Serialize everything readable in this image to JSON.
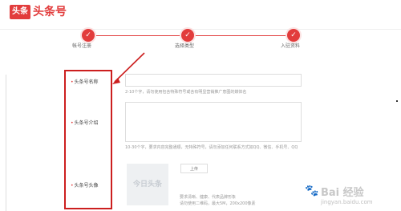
{
  "header": {
    "logo_badge": "头条",
    "logo_text": "头条号"
  },
  "steps": [
    {
      "label": "帐号注册",
      "icon": "check-icon"
    },
    {
      "label": "选择类型",
      "icon": "check-icon"
    },
    {
      "label": "入驻资料",
      "icon": "check-icon"
    }
  ],
  "form": {
    "name_label": "头条号名称",
    "name_hint": "2-10个字，请勿使用包含特殊符号或含有明显营销推广意图的媒体名",
    "intro_label": "头条号介绍",
    "intro_hint": "10-30个字，要求内容完整通顺，无特殊符号，请勿添加任何联系方式如QQ、微信、手机号、QQ",
    "avatar_label": "头条号头像",
    "avatar_placeholder": "今日头条",
    "upload_label": "上传",
    "avatar_hint_1": "要求清晰、健康、代表品牌形象",
    "avatar_hint_2": "请勿使用二维码，最大5M，200x200像素"
  },
  "watermark": {
    "text": "Bai 经验",
    "url": "jingyan.baidu.com"
  },
  "colors": {
    "brand_red": "#e23c3c",
    "annotation_red": "#cc1f1f"
  }
}
